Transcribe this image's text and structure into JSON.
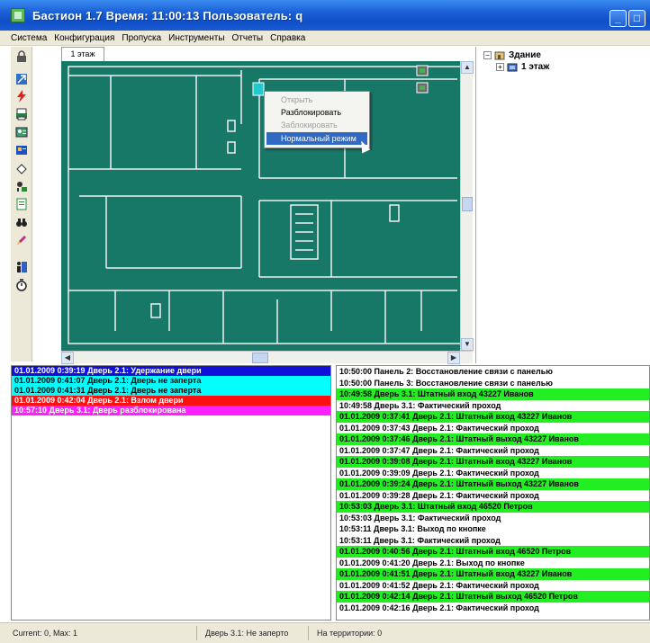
{
  "window": {
    "title": "Бастион 1.7 Время: 11:00:13 Пользователь: q",
    "minimize_glyph": "_",
    "close_glyph": "□"
  },
  "menu": [
    "Система",
    "Конфигурация",
    "Пропуска",
    "Инструменты",
    "Отчеты",
    "Справка"
  ],
  "toolbar_icons": [
    "lock-icon",
    "arrow-icon",
    "lightning-icon",
    "print-icon",
    "badge-icon",
    "id-card-icon",
    "eraser-icon",
    "key-user-icon",
    "document-icon",
    "binoculars-icon",
    "pencil-icon",
    "person-door-icon",
    "timer-icon"
  ],
  "map": {
    "tab_label": "1 этаж",
    "background_color": "#187868"
  },
  "context_menu": {
    "items": [
      {
        "label": "Открыть",
        "state": "disabled"
      },
      {
        "label": "Разблокировать",
        "state": "normal"
      },
      {
        "label": "Заблокировать",
        "state": "disabled"
      },
      {
        "label": "Нормальный режим",
        "state": "selected"
      }
    ]
  },
  "tree": {
    "root_label": "Здание",
    "child_label": "1 этаж"
  },
  "alarms": [
    {
      "text": "01.01.2009 0:39:19 Дверь   2.1: Удержание двери",
      "bg": "#1010d8",
      "fg": "#ffffff"
    },
    {
      "text": "01.01.2009 0:41:07 Дверь   2.1: Дверь не заперта",
      "bg": "#00ffff",
      "fg": "#000000"
    },
    {
      "text": "01.01.2009 0:41:31 Дверь   2.1: Дверь не заперта",
      "bg": "#00ffff",
      "fg": "#000000"
    },
    {
      "text": "01.01.2009 0:42:04 Дверь   2.1: Взлом двери",
      "bg": "#ff1010",
      "fg": "#ffffff"
    },
    {
      "text": "10:57:10 Дверь   3.1: Дверь разблокирована",
      "bg": "#ff20ff",
      "fg": "#ffffff"
    }
  ],
  "events": [
    {
      "text": "10:50:00 Панель   2: Восстановление связи с панелью",
      "bg": "#ffffff"
    },
    {
      "text": "10:50:00 Панель   3: Восстановление связи с панелью",
      "bg": "#ffffff"
    },
    {
      "text": "10:49:58 Дверь   3.1: Штатный вход 43227 Иванов",
      "bg": "#22ee22"
    },
    {
      "text": "10:49:58 Дверь   3.1: Фактический проход",
      "bg": "#ffffff"
    },
    {
      "text": "01.01.2009 0:37:41 Дверь   2.1: Штатный вход 43227 Иванов",
      "bg": "#22ee22"
    },
    {
      "text": "01.01.2009 0:37:43 Дверь   2.1: Фактический проход",
      "bg": "#ffffff"
    },
    {
      "text": "01.01.2009 0:37:46 Дверь   2.1: Штатный выход 43227 Иванов",
      "bg": "#22ee22"
    },
    {
      "text": "01.01.2009 0:37:47 Дверь   2.1: Фактический проход",
      "bg": "#ffffff"
    },
    {
      "text": "01.01.2009 0:39:08 Дверь   2.1: Штатный вход 43227 Иванов",
      "bg": "#22ee22"
    },
    {
      "text": "01.01.2009 0:39:09 Дверь   2.1: Фактический проход",
      "bg": "#ffffff"
    },
    {
      "text": "01.01.2009 0:39:24 Дверь   2.1: Штатный выход 43227 Иванов",
      "bg": "#22ee22"
    },
    {
      "text": "01.01.2009 0:39:28 Дверь   2.1: Фактический проход",
      "bg": "#ffffff"
    },
    {
      "text": "10:53:03 Дверь   3.1: Штатный вход 46520 Петров",
      "bg": "#22ee22"
    },
    {
      "text": "10:53:03 Дверь   3.1: Фактический проход",
      "bg": "#ffffff"
    },
    {
      "text": "10:53:11 Дверь   3.1: Выход по кнопке",
      "bg": "#ffffff"
    },
    {
      "text": "10:53:11 Дверь   3.1: Фактический проход",
      "bg": "#ffffff"
    },
    {
      "text": "01.01.2009 0:40:56 Дверь   2.1: Штатный вход 46520 Петров",
      "bg": "#22ee22"
    },
    {
      "text": "01.01.2009 0:41:20 Дверь   2.1: Выход по кнопке",
      "bg": "#ffffff"
    },
    {
      "text": "01.01.2009 0:41:51 Дверь   2.1: Штатный вход 43227 Иванов",
      "bg": "#22ee22"
    },
    {
      "text": "01.01.2009 0:41:52 Дверь   2.1: Фактический проход",
      "bg": "#ffffff"
    },
    {
      "text": "01.01.2009 0:42:14 Дверь   2.1: Штатный выход 46520 Петров",
      "bg": "#22ee22"
    },
    {
      "text": "01.01.2009 0:42:16 Дверь   2.1: Фактический проход",
      "bg": "#ffffff"
    }
  ],
  "statusbar": {
    "counts": "Current: 0, Max: 1",
    "door_status": "Дверь   3.1: Не заперто",
    "territory": "На территории: 0"
  }
}
